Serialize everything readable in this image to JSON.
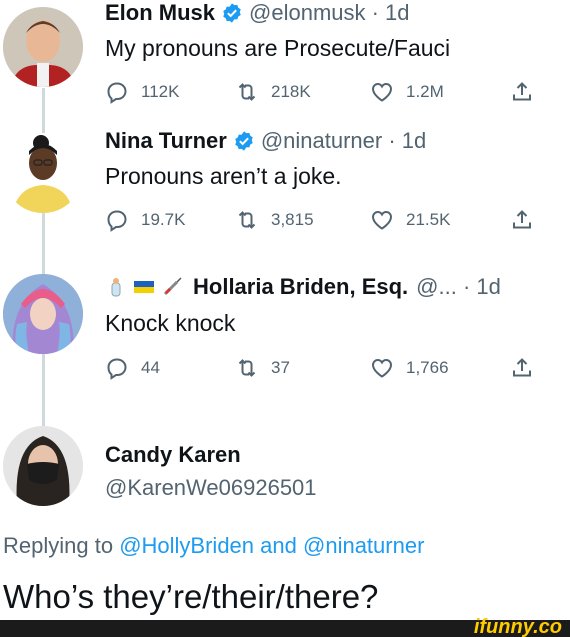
{
  "tweets": [
    {
      "name": "Elon Musk",
      "handle": "@elonmusk · 1d",
      "text": "My pronouns are Prosecute/Fauci",
      "replies": "112K",
      "retweets": "218K",
      "likes": "1.2M",
      "verified": true
    },
    {
      "name": "Nina Turner",
      "handle": "@ninaturner · 1d",
      "text": "Pronouns aren’t a joke.",
      "replies": "19.7K",
      "retweets": "3,815",
      "likes": "21.5K",
      "verified": true
    },
    {
      "name": "Hollaria Briden, Esq.",
      "handle": "@... · 1d",
      "text": "Knock knock",
      "replies": "44",
      "retweets": "37",
      "likes": "1,766",
      "verified": false
    }
  ],
  "reply_tweet": {
    "name": "Candy Karen",
    "handle": "@KarenWe06926501",
    "replying_prefix": "Replying to",
    "replying_mention_1": "@HollyBriden",
    "replying_and": "and",
    "replying_mention_2": "@ninaturner",
    "text": "Who’s they’re/their/there?"
  },
  "watermark": "ifunny.co",
  "colors": {
    "accent": "#1d9bf0",
    "muted": "#536471",
    "text": "#0f1419"
  },
  "icons": [
    "reply-icon",
    "retweet-icon",
    "like-icon",
    "share-icon",
    "verified-badge-icon"
  ]
}
